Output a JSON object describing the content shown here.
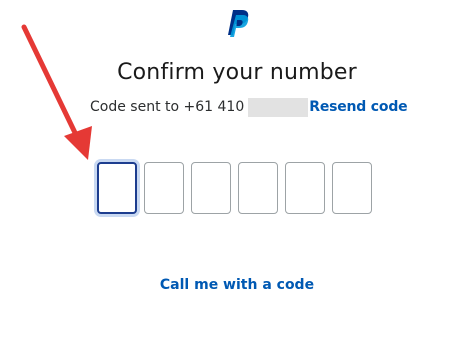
{
  "brand": {
    "logo_icon": "paypal-logo-icon",
    "primary_color": "#003087",
    "secondary_color": "#009cde"
  },
  "heading": {
    "title": "Confirm your number"
  },
  "sent_info": {
    "text": "Code sent to +61 410",
    "resend_label": "Resend code"
  },
  "code_inputs": {
    "count": 6,
    "values": [
      "",
      "",
      "",
      "",
      "",
      ""
    ],
    "active_index": 0
  },
  "call_option": {
    "label": "Call me with a code"
  },
  "annotation": {
    "icon": "red-arrow-icon",
    "color": "#e53935"
  }
}
